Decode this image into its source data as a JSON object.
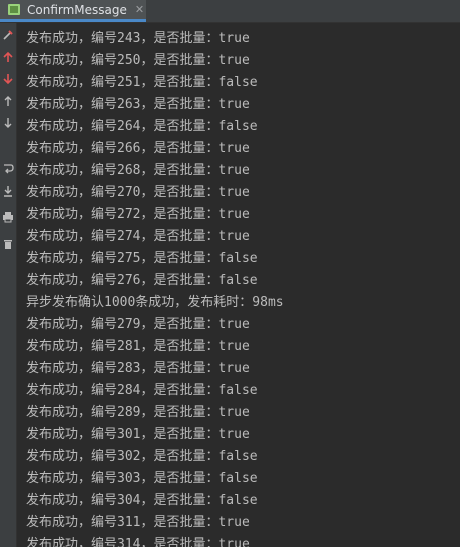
{
  "tab": {
    "label": "ConfirmMessage",
    "close_glyph": "✕",
    "icon": "java-class-icon"
  },
  "toolbar": {
    "buttons": [
      "pin-icon",
      "up-arrow-icon",
      "down-arrow-icon",
      "scroll-up-icon",
      "scroll-down-icon",
      "soft-wrap-icon",
      "scroll-to-end-icon",
      "print-icon",
      "trash-icon"
    ]
  },
  "colors": {
    "background": "#2b2b2b",
    "text": "#bbbbbb",
    "tab_accent": "#4a88c7",
    "toolbar_red": "#e05555"
  },
  "console": {
    "lines": [
      "发布成功，编号243，是否批量：true",
      "发布成功，编号250，是否批量：true",
      "发布成功，编号251，是否批量：false",
      "发布成功，编号263，是否批量：true",
      "发布成功，编号264，是否批量：false",
      "发布成功，编号266，是否批量：true",
      "发布成功，编号268，是否批量：true",
      "发布成功，编号270，是否批量：true",
      "发布成功，编号272，是否批量：true",
      "发布成功，编号274，是否批量：true",
      "发布成功，编号275，是否批量：false",
      "发布成功，编号276，是否批量：false",
      "异步发布确认1000条成功，发布耗时：98ms",
      "发布成功，编号279，是否批量：true",
      "发布成功，编号281，是否批量：true",
      "发布成功，编号283，是否批量：true",
      "发布成功，编号284，是否批量：false",
      "发布成功，编号289，是否批量：true",
      "发布成功，编号301，是否批量：true",
      "发布成功，编号302，是否批量：false",
      "发布成功，编号303，是否批量：false",
      "发布成功，编号304，是否批量：false",
      "发布成功，编号311，是否批量：true",
      "发布成功，编号314，是否批量：true"
    ]
  }
}
